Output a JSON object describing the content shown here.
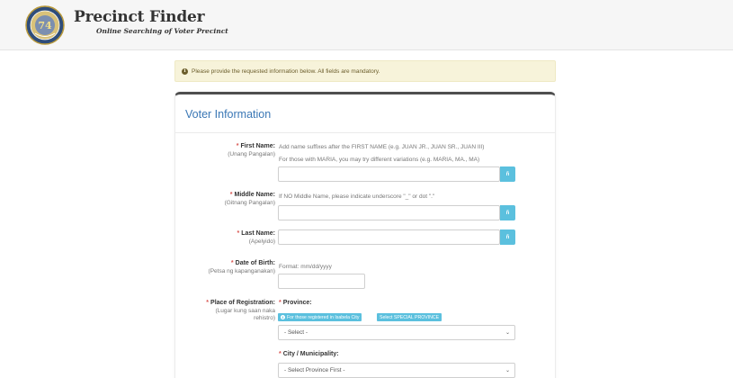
{
  "header": {
    "title": "Precinct Finder",
    "subtitle": "Online Searching of Voter Precinct"
  },
  "alert": {
    "icon": "info-circle-icon",
    "message": "Please provide the requested information below. All fields are mandatory."
  },
  "panel": {
    "title": "Voter Information"
  },
  "form": {
    "required_mark": "*",
    "first_name": {
      "label": "First Name:",
      "translation": "(Unang Pangalan)",
      "hint1": "Add name suffixes after the FIRST NAME (e.g. JUAN JR., JUAN SR., JUAN III)",
      "hint2": "For those with MARIA, you may try different variations (e.g. MARIA, MA., MA)",
      "addon": "ñ"
    },
    "middle_name": {
      "label": "Middle Name:",
      "translation": "(Gitnang Pangalan)",
      "hint": "If NO Middle Name, please indicate underscore \"_\" or dot \".\"",
      "addon": "ñ"
    },
    "last_name": {
      "label": "Last Name:",
      "translation": "(Apelyido)",
      "addon": "ñ"
    },
    "dob": {
      "label": "Date of Birth:",
      "translation": "(Petsa ng kapanganakan)",
      "hint": "Format: mm/dd/yyyy"
    },
    "registration": {
      "label": "Place of Registration:",
      "translation_line1": "(Lugar kung saan naka",
      "translation_line2": "rehistro)",
      "province_label": "Province:",
      "isabela_badge": "For those registered in Isabela City",
      "special_badge": "Select SPECIAL PROVINCE",
      "province_value": "- Select -",
      "city_label": "City / Municipality:",
      "city_value": "- Select Province First -"
    }
  }
}
